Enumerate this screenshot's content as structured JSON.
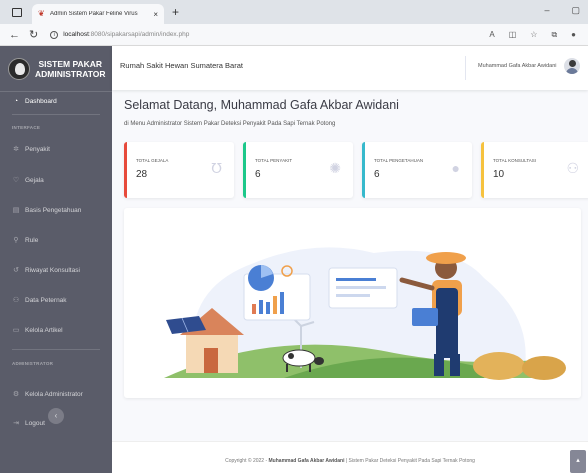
{
  "browser": {
    "tab_title": "Admin Sistem Pakar Feline Virus",
    "url_host": "localhost",
    "url_path": ":8080/sipakarsapi/admin/index.php",
    "new_tab": "+",
    "close": "×"
  },
  "brand": {
    "line1": "SISTEM PAKAR",
    "line2": "ADMINISTRATOR"
  },
  "sidebar": {
    "dashboard": "Dashboard",
    "heading_interface": "INTERFACE",
    "items": [
      "Penyakit",
      "Gejala",
      "Basis Pengetahuan",
      "Rule",
      "Riwayat Konsultasi",
      "Data Peternak",
      "Kelola Artikel"
    ],
    "heading_admin": "ADMINISTRATOR",
    "admin_items": [
      "Kelola Administrator",
      "Logout"
    ]
  },
  "topbar": {
    "hospital": "Rumah Sakit Hewan Sumatera Barat",
    "user": "Muhammad Gafa Akbar Awidani"
  },
  "welcome": {
    "title": "Selamat Datang, Muhammad Gafa Akbar Awidani",
    "subtitle": "di Menu Administrator Sistem Pakar Deteksi Penyakit Pada Sapi Ternak Potong"
  },
  "cards": [
    {
      "label": "TOTAL GEJALA",
      "value": "28",
      "color": "#e74a3b",
      "icon": "stethoscope-icon"
    },
    {
      "label": "TOTAL PENYAKIT",
      "value": "6",
      "color": "#1cc88a",
      "icon": "virus-icon"
    },
    {
      "label": "TOTAL PENGETAHUAN",
      "value": "6",
      "color": "#36b9cc",
      "icon": "comment-icon"
    },
    {
      "label": "TOTAL KONSULTASI",
      "value": "10",
      "color": "#f6c23e",
      "icon": "users-icon"
    }
  ],
  "footer": {
    "prefix": "Copyright © 2022 - ",
    "author": "Muhammad Gafa Akbar Awidani",
    "suffix": " | Sistem Pakar Deteksi Penyakit Pada Sapi Ternak Potong"
  }
}
